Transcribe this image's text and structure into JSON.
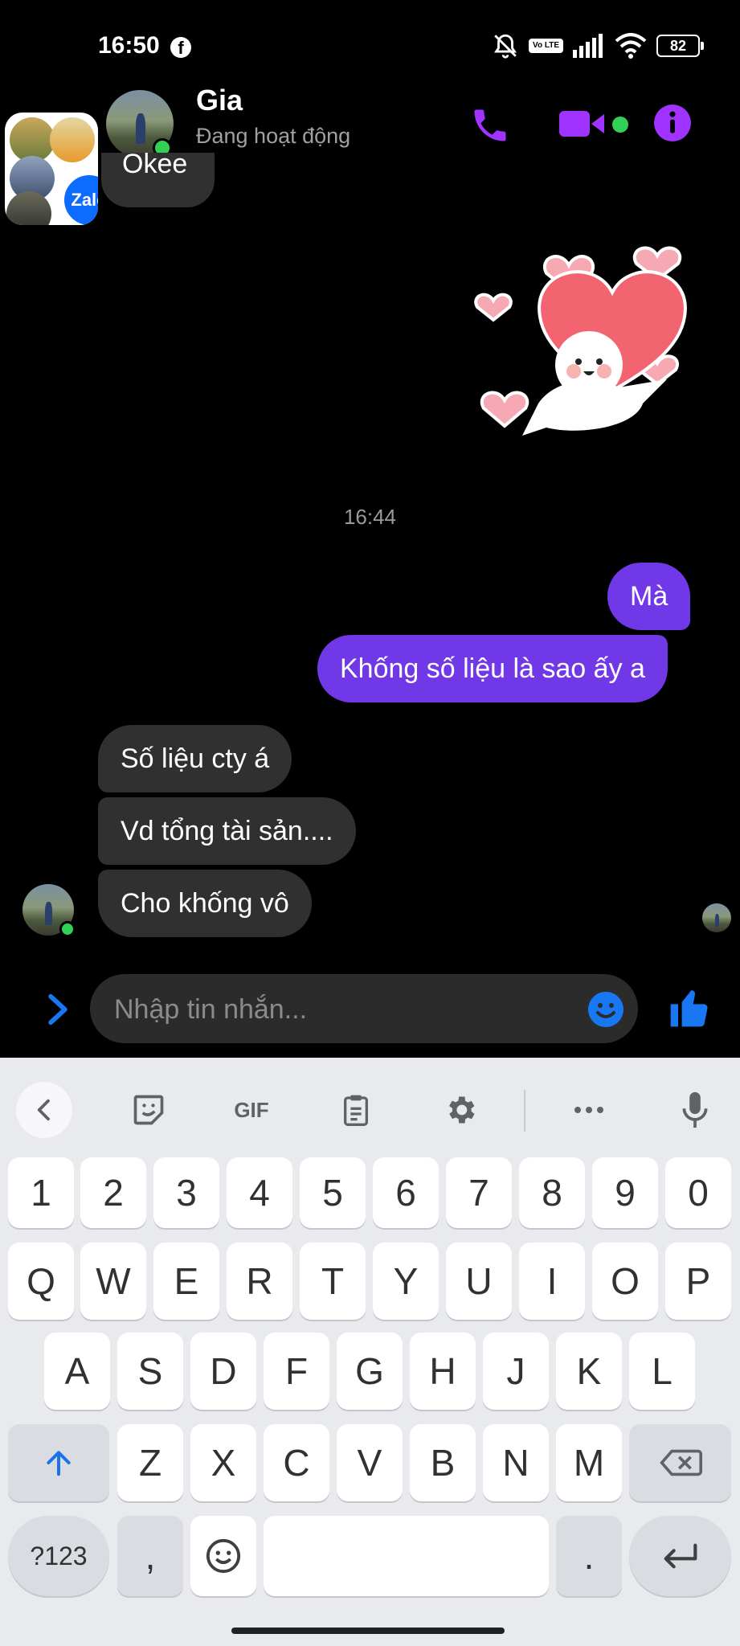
{
  "status_bar": {
    "time": "16:50",
    "app_icon": "f",
    "volte": "Vo LTE",
    "battery": "82"
  },
  "header": {
    "name": "Gia",
    "status": "Đang hoạt động"
  },
  "zalo": {
    "label": "Zalo"
  },
  "messages": {
    "partial_top": "Okee",
    "time_separator": "16:44",
    "out1": "Mà",
    "out2": "Khống số liệu là sao ấy a",
    "in1": "Số liệu cty á",
    "in2": "Vd tổng tài sản....",
    "in3": "Cho khống vô"
  },
  "composer": {
    "placeholder": "Nhập tin nhắn..."
  },
  "keyboard": {
    "toolbar": {
      "gif": "GIF"
    },
    "row_numbers": [
      "1",
      "2",
      "3",
      "4",
      "5",
      "6",
      "7",
      "8",
      "9",
      "0"
    ],
    "row_q": [
      "Q",
      "W",
      "E",
      "R",
      "T",
      "Y",
      "U",
      "I",
      "O",
      "P"
    ],
    "row_a": [
      "A",
      "S",
      "D",
      "F",
      "G",
      "H",
      "J",
      "K",
      "L"
    ],
    "row_z": [
      "Z",
      "X",
      "C",
      "V",
      "B",
      "N",
      "M"
    ],
    "symbols": "?123",
    "comma": ",",
    "period": "."
  },
  "colors": {
    "accent": "#a033ff",
    "outgoing_bubble": "#7138e8",
    "incoming_bubble": "#303030",
    "like": "#1877f2",
    "online": "#31d158"
  }
}
